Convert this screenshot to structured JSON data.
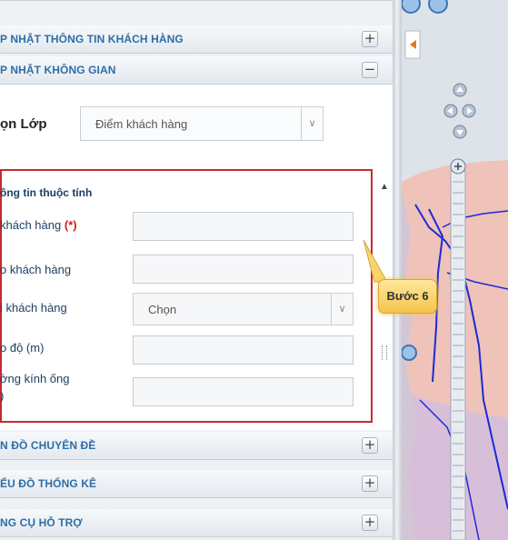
{
  "sidebar": {
    "sections": [
      {
        "title": "P NHẬT THÔNG TIN KHÁCH HÀNG",
        "toggle": "+"
      },
      {
        "title": "P NHẬT KHÔNG GIAN",
        "toggle": "−"
      },
      {
        "title": "N ĐỒ CHUYÊN ĐỀ",
        "toggle": "+"
      },
      {
        "title": "ỂU ĐỒ THỐNG KÊ",
        "toggle": "+"
      },
      {
        "title": "NG CỤ HỖ TRỢ",
        "toggle": "+"
      }
    ],
    "layer": {
      "label": "ọn Lớp",
      "selected": "Điểm khách hàng"
    },
    "form": {
      "title": "ông tin thuộc tính",
      "fields": [
        {
          "label": "khách hàng",
          "required": "(*)"
        },
        {
          "label": "o khách hàng"
        },
        {
          "label": "i khách hàng",
          "selected": "Chọn"
        },
        {
          "label": "o độ (m)"
        },
        {
          "label_line1": "ờng kính ống",
          "label_line2": ")"
        }
      ]
    }
  },
  "map": {
    "tooltip": "Bước 6",
    "colors": {
      "region": "#f1c6bd",
      "region_alt": "#d8b8d2",
      "road": "#1a2bd6",
      "water": "#b8d4ec"
    }
  },
  "icons": {
    "expand": "plus-icon",
    "collapse": "minus-icon",
    "dropdown": "chevron-down-icon",
    "pan": "pan-control-icon",
    "zoom_in": "zoom-in-icon",
    "collapse_map": "arrow-left-icon"
  }
}
